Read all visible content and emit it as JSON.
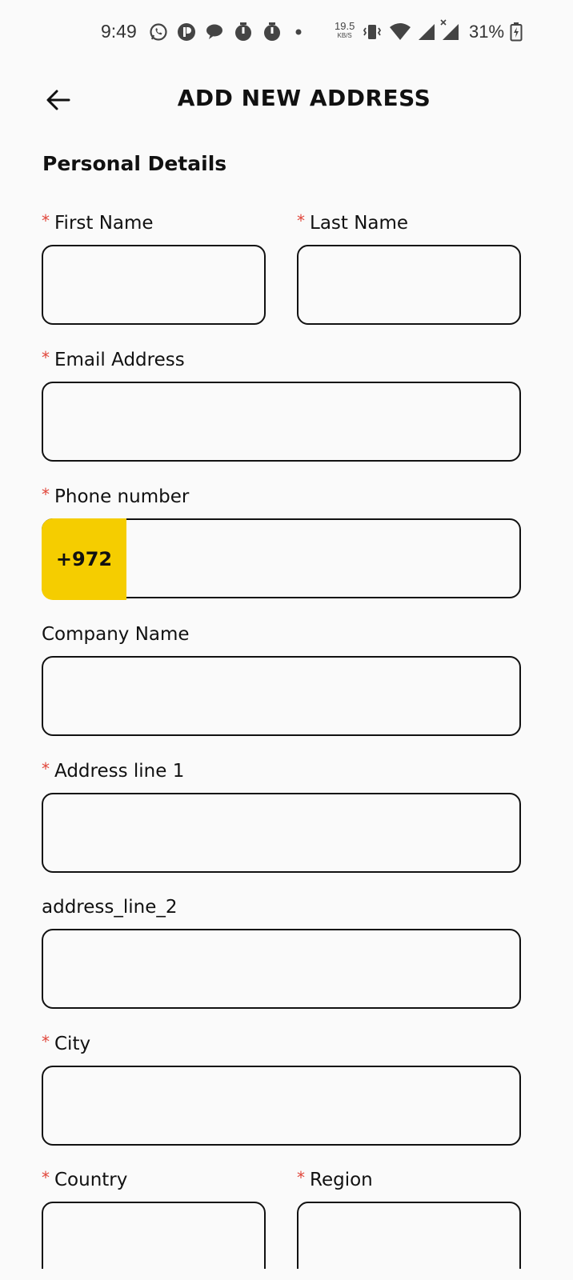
{
  "status_bar": {
    "time": "9:49",
    "net_speed_value": "19.5",
    "net_speed_unit": "KB/S",
    "battery_percent": "31%",
    "icons": [
      "whatsapp-icon",
      "app-icon",
      "chat-icon",
      "timer-icon",
      "timer-icon",
      "dot-icon",
      "vibrate-icon",
      "wifi-icon",
      "signal-icon",
      "signal-x-icon",
      "battery-icon"
    ]
  },
  "header": {
    "title": "ADD NEW ADDRESS",
    "back_icon": "arrow-left-icon"
  },
  "section": {
    "title": "Personal Details"
  },
  "form": {
    "required_marker": "*",
    "first_name": {
      "label": "First Name",
      "value": "",
      "required": true
    },
    "last_name": {
      "label": "Last Name",
      "value": "",
      "required": true
    },
    "email": {
      "label": "Email Address",
      "value": "",
      "required": true
    },
    "phone": {
      "label": "Phone number",
      "prefix": "+972",
      "value": "",
      "required": true
    },
    "company": {
      "label": "Company Name",
      "value": "",
      "required": false
    },
    "address_line_1": {
      "label": "Address line 1",
      "value": "",
      "required": true
    },
    "address_line_2": {
      "label": "address_line_2",
      "value": "",
      "required": false
    },
    "city": {
      "label": "City",
      "value": "",
      "required": true
    },
    "country": {
      "label": "Country",
      "value": "",
      "required": true
    },
    "region": {
      "label": "Region",
      "value": "",
      "required": true
    }
  },
  "colors": {
    "accent": "#f5cd00",
    "required": "#e0453a",
    "border": "#111111",
    "background": "#fafafa"
  }
}
